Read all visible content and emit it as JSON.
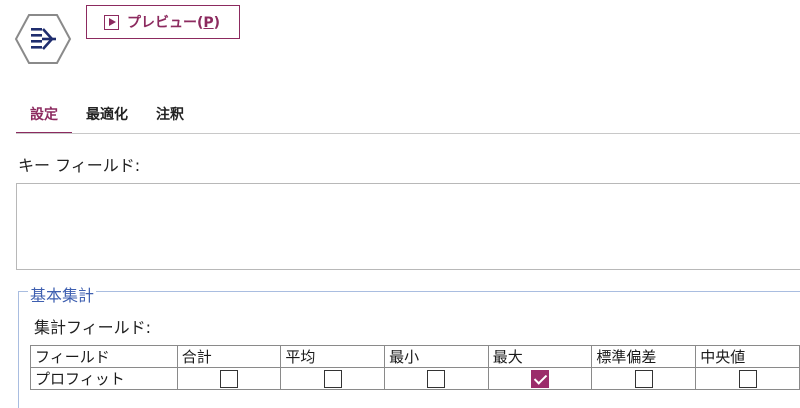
{
  "node": {
    "icon": "aggregate-node-icon"
  },
  "toolbar": {
    "preview_label": "プレビュー(",
    "preview_mnemonic": "P",
    "preview_suffix": ")"
  },
  "tabs": [
    {
      "label": "設定",
      "active": true
    },
    {
      "label": "最適化",
      "active": false
    },
    {
      "label": "注釈",
      "active": false
    }
  ],
  "key_fields": {
    "label": "キー フィールド:",
    "items": []
  },
  "basic_aggregates": {
    "title": "基本集計",
    "agg_fields_label": "集計フィールド:",
    "columns": [
      "フィールド",
      "合計",
      "平均",
      "最小",
      "最大",
      "標準偏差",
      "中央値"
    ],
    "rows": [
      {
        "field": "プロフィット",
        "checks": [
          false,
          false,
          false,
          true,
          false,
          false
        ]
      }
    ]
  },
  "colors": {
    "accent": "#8c2a5f",
    "group_title": "#3e5fb0",
    "group_border": "#a9bde0"
  }
}
